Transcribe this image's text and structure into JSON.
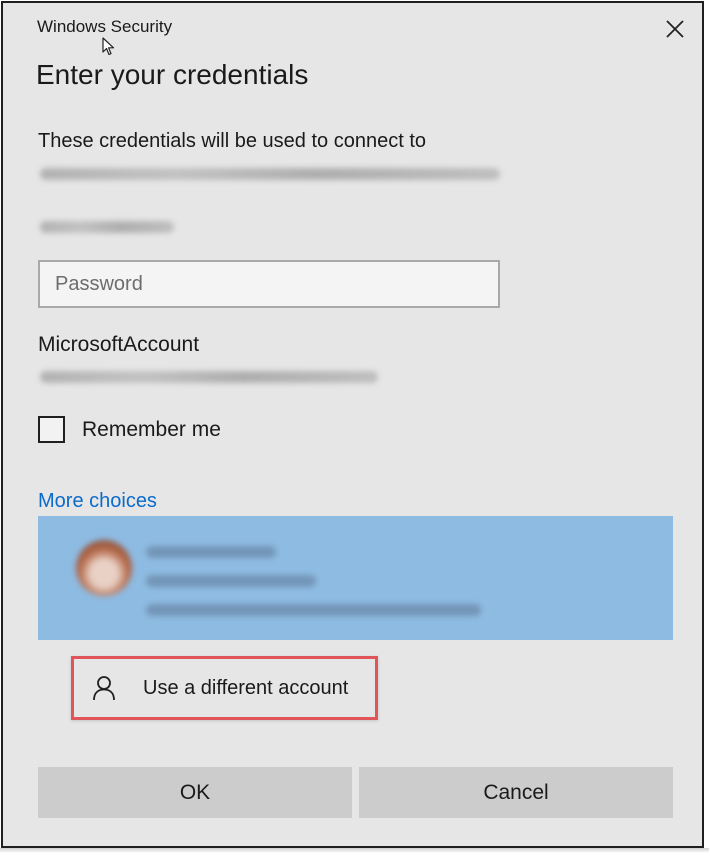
{
  "window": {
    "title": "Windows Security",
    "close_icon": "close-icon"
  },
  "dialog": {
    "heading": "Enter your credentials",
    "description": "These credentials will be used to connect to"
  },
  "password_field": {
    "placeholder": "Password",
    "value": ""
  },
  "account_section": {
    "label": "MicrosoftAccount"
  },
  "remember_me": {
    "label": "Remember me",
    "checked": false
  },
  "more_choices": {
    "link_label": "More choices",
    "selected_tile_color": "#8ebbe2"
  },
  "use_different_account": {
    "label": "Use a different account",
    "icon": "person-icon",
    "highlight_color": "#e0555a"
  },
  "buttons": {
    "ok_label": "OK",
    "cancel_label": "Cancel"
  },
  "colors": {
    "dialog_bg": "#e6e6e6",
    "link": "#0b6bcb",
    "button_bg": "#cccccc"
  }
}
